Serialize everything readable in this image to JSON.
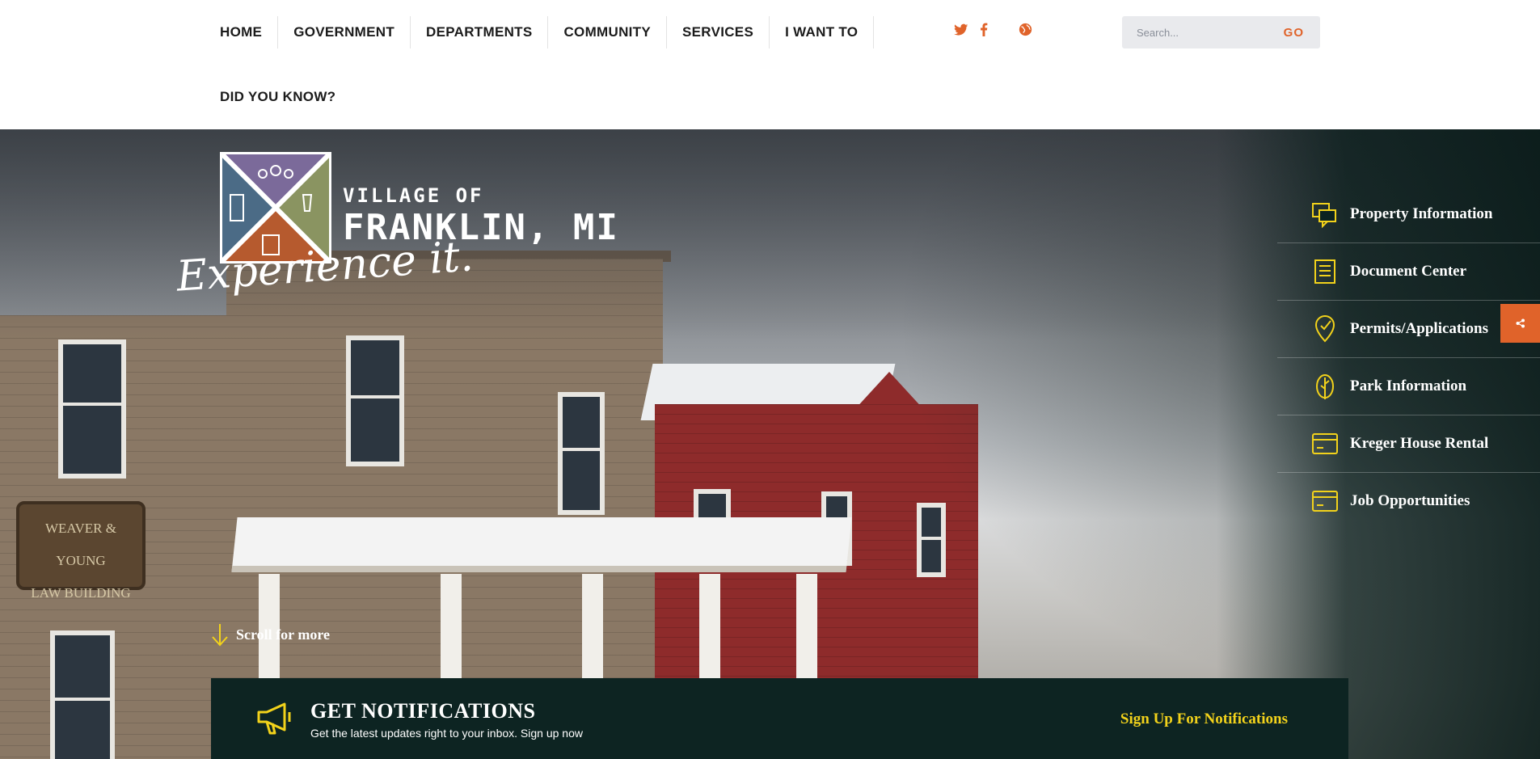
{
  "nav": {
    "items": [
      {
        "label": "HOME"
      },
      {
        "label": "GOVERNMENT"
      },
      {
        "label": "DEPARTMENTS"
      },
      {
        "label": "COMMUNITY"
      },
      {
        "label": "SERVICES"
      },
      {
        "label": "I WANT TO"
      }
    ],
    "row2": {
      "label": "DID YOU KNOW?"
    }
  },
  "social": {
    "twitter": "twitter-icon",
    "facebook": "facebook-icon",
    "globe": "globe-icon"
  },
  "search": {
    "placeholder": "Search...",
    "go_label": "GO"
  },
  "logo": {
    "line1": "VILLAGE OF",
    "line2": "FRANKLIN, MI",
    "tagline": "Experience it."
  },
  "hero_sign": {
    "line1": "WEAVER & YOUNG",
    "line2": "LAW BUILDING"
  },
  "quicklinks": [
    {
      "label": "Property Information",
      "icon": "chat-bubbles-icon"
    },
    {
      "label": "Document Center",
      "icon": "document-icon"
    },
    {
      "label": "Permits/Applications",
      "icon": "checkmark-pin-icon"
    },
    {
      "label": "Park Information",
      "icon": "leaf-icon"
    },
    {
      "label": "Kreger House Rental",
      "icon": "card-icon"
    },
    {
      "label": "Job Opportunities",
      "icon": "card-icon"
    }
  ],
  "scroll": {
    "label": "Scroll for more"
  },
  "notifications": {
    "title": "GET NOTIFICATIONS",
    "subtitle": "Get the latest updates right to your inbox. Sign up now",
    "link": "Sign Up For Notifications"
  },
  "colors": {
    "accent": "#e0632a",
    "yellow": "#f2d21b",
    "dark_green": "#0d2422"
  }
}
